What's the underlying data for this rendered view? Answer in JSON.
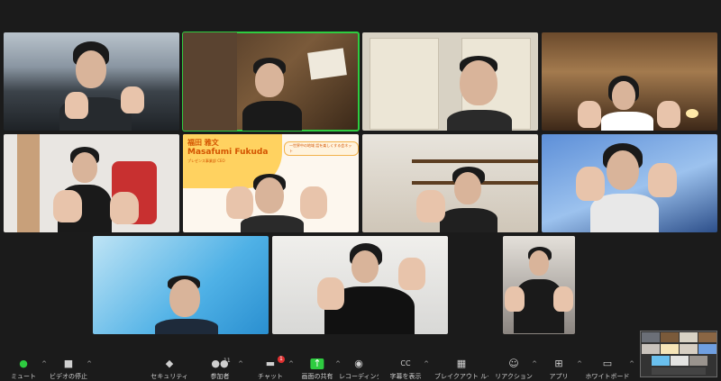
{
  "participant_card": {
    "name_jp": "福田 雅文",
    "name_en": "Masafumi Fukuda",
    "role": "プレゼンス事業部 CEO",
    "tagline": "一世界中の地域 話を楽しくする会ネット"
  },
  "toolbar": {
    "items": [
      {
        "key": "mute",
        "label": "ミュート",
        "icon": "mic-icon"
      },
      {
        "key": "video",
        "label": "ビデオの停止",
        "icon": "camera-icon"
      },
      {
        "key": "security",
        "label": "セキュリティ",
        "icon": "shield-icon"
      },
      {
        "key": "participants",
        "label": "参加者",
        "icon": "people-icon",
        "count": "11"
      },
      {
        "key": "chat",
        "label": "チャット",
        "icon": "chat-icon",
        "badge": "1"
      },
      {
        "key": "share",
        "label": "画面の共有",
        "icon": "share-screen-icon"
      },
      {
        "key": "record",
        "label": "レコーディング",
        "icon": "record-icon"
      },
      {
        "key": "captions",
        "label": "字幕を表示",
        "icon": "cc-icon"
      },
      {
        "key": "breakout",
        "label": "ブレイクアウト ルーム",
        "icon": "grid-icon"
      },
      {
        "key": "reactions",
        "label": "リアクション",
        "icon": "smile-icon"
      },
      {
        "key": "apps",
        "label": "アプリ",
        "icon": "apps-icon"
      },
      {
        "key": "whiteboard",
        "label": "ホワイトボード",
        "icon": "whiteboard-icon"
      }
    ]
  },
  "colors": {
    "active_speaker": "#2ecc40",
    "share_green": "#2ecc40",
    "background": "#1b1b1b",
    "accent_orange": "#d35400"
  }
}
